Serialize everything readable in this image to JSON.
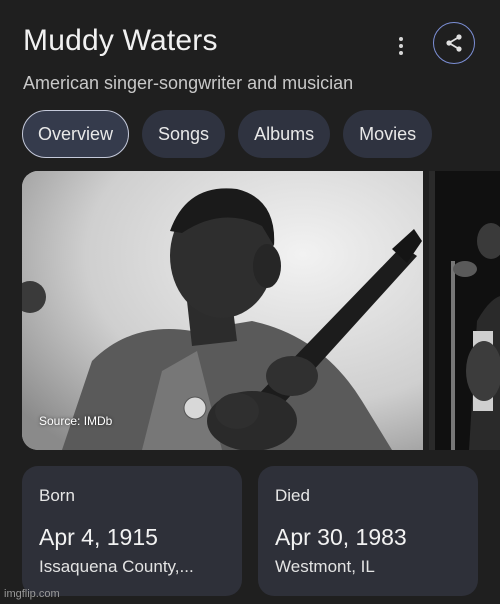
{
  "header": {
    "title": "Muddy Waters",
    "subtitle": "American singer-songwriter and musician"
  },
  "tabs": [
    {
      "label": "Overview",
      "active": true
    },
    {
      "label": "Songs"
    },
    {
      "label": "Albums"
    },
    {
      "label": "Movies"
    }
  ],
  "image": {
    "source": "Source: IMDb"
  },
  "born": {
    "label": "Born",
    "date": "Apr 4, 1915",
    "place": "Issaquena County,..."
  },
  "died": {
    "label": "Died",
    "date": "Apr 30, 1983",
    "place": "Westmont, IL"
  },
  "watermark": "imgflip.com",
  "colors": {
    "background": "#1f1f1f",
    "chip": "#2f3340",
    "card": "#2e3039",
    "accent": "#7c8fd6"
  },
  "icons": [
    "more-vert-icon",
    "share-icon"
  ]
}
